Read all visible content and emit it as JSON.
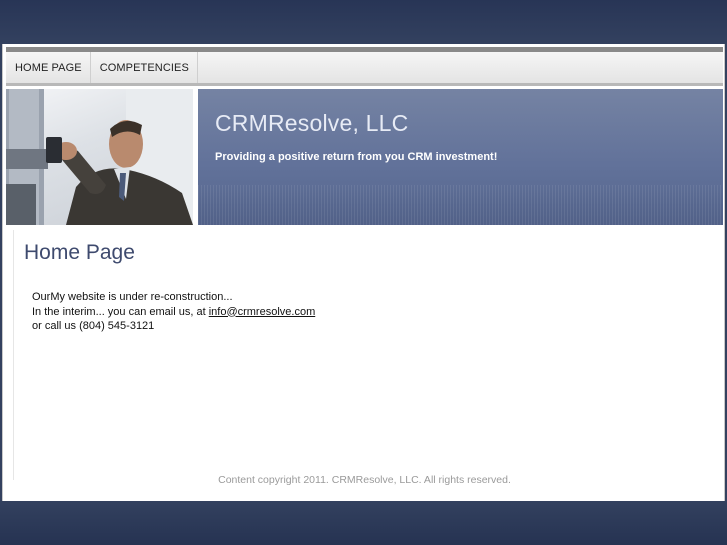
{
  "nav": {
    "items": [
      {
        "label": "HOME PAGE"
      },
      {
        "label": "COMPETENCIES"
      }
    ]
  },
  "header": {
    "title": "CRMResolve, LLC",
    "tagline": "Providing a positive return from you CRM investment!"
  },
  "main": {
    "heading": "Home Page",
    "line1": "OurMy website is under re-construction...",
    "line2_prefix": "In the interim... you can email us, at ",
    "email": "info@crmresolve.com",
    "line3": "or call us (804) 545-3121"
  },
  "footer": {
    "copyright": "Content copyright 2011. CRMResolve, LLC. All rights reserved."
  },
  "colors": {
    "background": "#33415f",
    "banner": "#62729a",
    "heading": "#3e4a6e"
  }
}
